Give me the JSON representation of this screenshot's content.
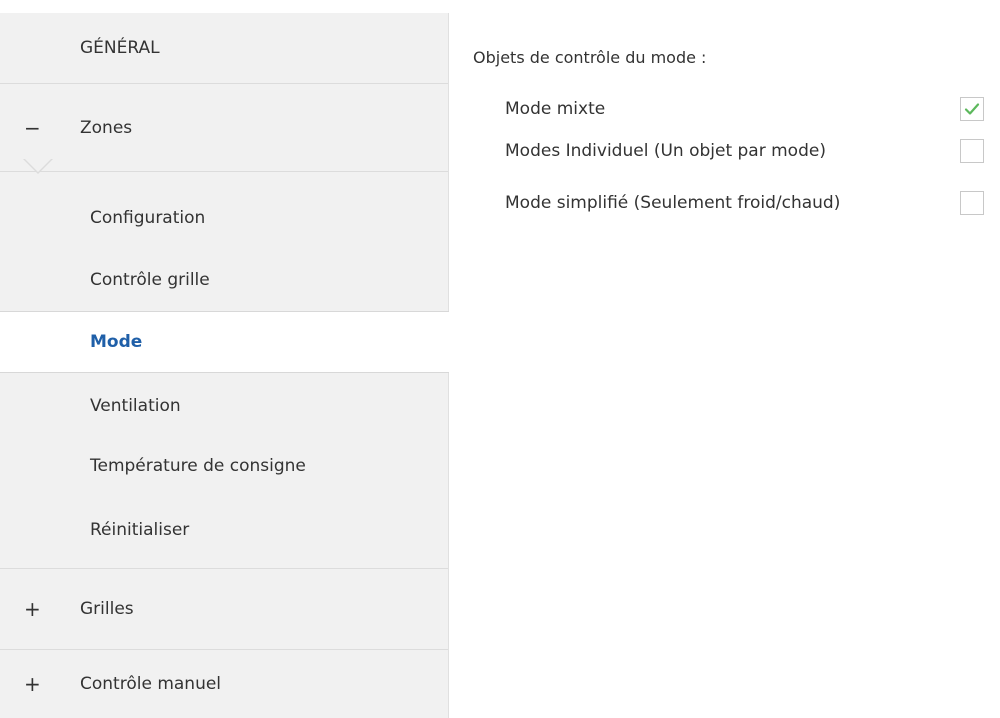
{
  "sidebar": {
    "general": {
      "label": "GÉNÉRAL"
    },
    "zones": {
      "expander": "−",
      "label": "Zones",
      "items": [
        {
          "label": "Configuration"
        },
        {
          "label": "Contrôle grille"
        },
        {
          "label": "Mode"
        },
        {
          "label": "Ventilation"
        },
        {
          "label": "Température de consigne"
        },
        {
          "label": "Réinitialiser"
        }
      ],
      "active_item": "Mode"
    },
    "grilles": {
      "expander": "+",
      "label": "Grilles"
    },
    "controle_manuel": {
      "expander": "+",
      "label": "Contrôle manuel"
    }
  },
  "content": {
    "section_title": "Objets de contrôle du mode :",
    "options": [
      {
        "label": "Mode mixte",
        "checked": true
      },
      {
        "label": "Modes Individuel (Un objet par mode)",
        "checked": false
      },
      {
        "label": "Mode simplifié (Seulement froid/chaud)",
        "checked": false
      }
    ]
  },
  "colors": {
    "sidebar_bg": "#f1f1f1",
    "active_text": "#1f5fa8",
    "check_green": "#5cb85c"
  }
}
